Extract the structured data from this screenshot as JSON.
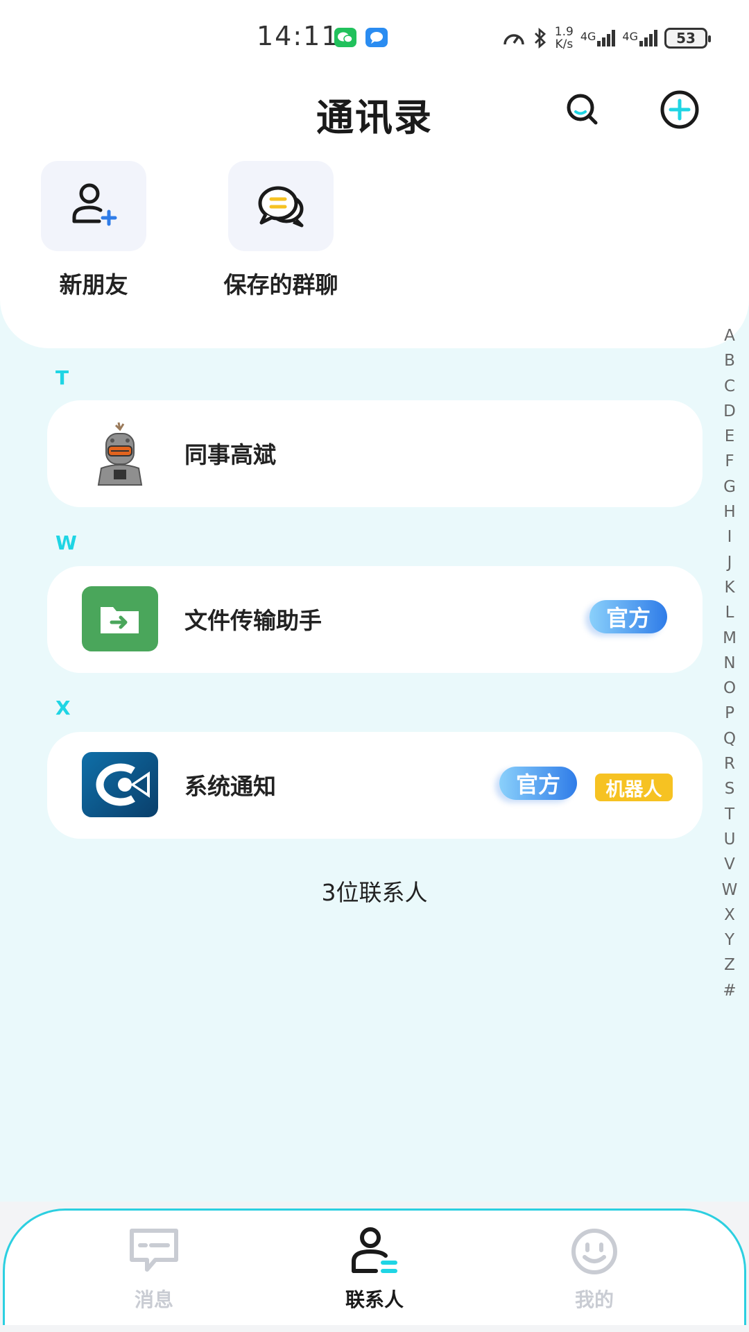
{
  "status_bar": {
    "time": "14:11",
    "net_speed_value": "1.9",
    "net_speed_unit": "K/s",
    "network_1": "4G",
    "network_2": "4G",
    "battery": "53",
    "icons": [
      "wechat-icon",
      "message-icon",
      "speed-icon",
      "bluetooth-icon"
    ]
  },
  "header": {
    "title": "通讯录",
    "icons": [
      "search-icon",
      "add-icon"
    ]
  },
  "quick_actions": [
    {
      "label": "新朋友",
      "icon": "add-friend-icon"
    },
    {
      "label": "保存的群聊",
      "icon": "group-chat-icon"
    }
  ],
  "alphabet_index": [
    "A",
    "B",
    "C",
    "D",
    "E",
    "F",
    "G",
    "H",
    "I",
    "J",
    "K",
    "L",
    "M",
    "N",
    "O",
    "P",
    "Q",
    "R",
    "S",
    "T",
    "U",
    "V",
    "W",
    "X",
    "Y",
    "Z",
    "#"
  ],
  "sections": [
    {
      "letter": "T",
      "contacts": [
        {
          "name": "同事高斌",
          "tags": []
        }
      ]
    },
    {
      "letter": "W",
      "contacts": [
        {
          "name": "文件传输助手",
          "tags": [
            "官方"
          ]
        }
      ]
    },
    {
      "letter": "X",
      "contacts": [
        {
          "name": "系统通知",
          "tags": [
            "官方",
            "机器人"
          ]
        }
      ]
    }
  ],
  "contact_count": "3位联系人",
  "tabbar": {
    "tabs": [
      {
        "label": "消息",
        "icon": "message-tab-icon",
        "active": false
      },
      {
        "label": "联系人",
        "icon": "contacts-tab-icon",
        "active": true
      },
      {
        "label": "我的",
        "icon": "profile-tab-icon",
        "active": false
      }
    ]
  },
  "colors": {
    "accent": "#1fd5e4",
    "tag_official": "#2f7ce8",
    "tag_robot": "#f6c222",
    "inactive_tab": "#c9ccd3",
    "background": "#eaf9fb"
  }
}
